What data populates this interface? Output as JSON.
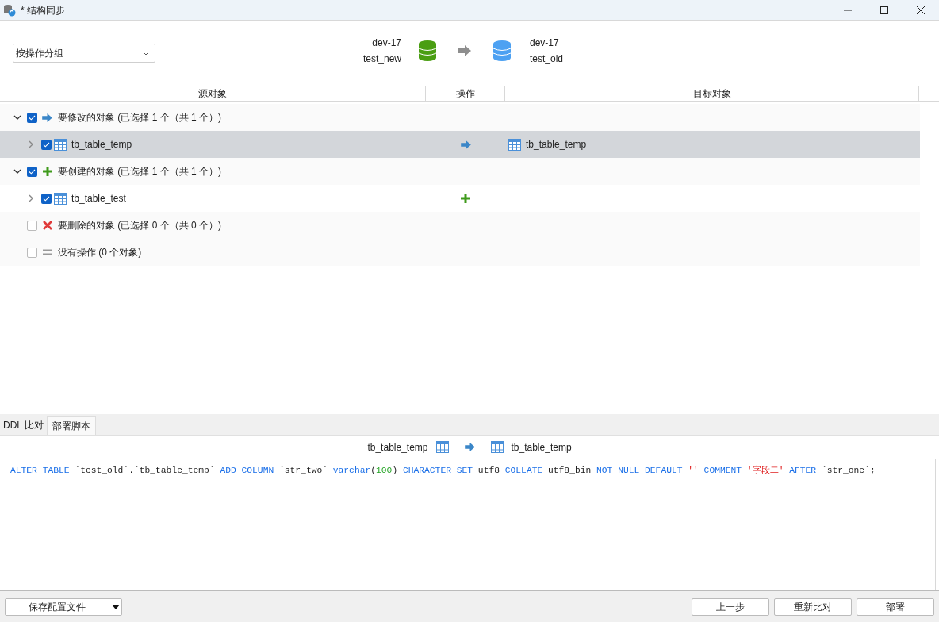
{
  "window": {
    "title": "* 结构同步"
  },
  "group_by": {
    "value": "按操作分组"
  },
  "source": {
    "server": "dev-17",
    "database": "test_new"
  },
  "target": {
    "server": "dev-17",
    "database": "test_old"
  },
  "table": {
    "columns": [
      "源对象",
      "操作",
      "目标对象"
    ],
    "groups": [
      {
        "kind": "modify",
        "label": "要修改的对象 (已选择 1 个（共 1 个）)",
        "checked": true,
        "expanded": true,
        "children": [
          {
            "name": "tb_table_temp",
            "checked": true,
            "selected": true,
            "expanded": false,
            "target": "tb_table_temp"
          }
        ]
      },
      {
        "kind": "create",
        "label": "要创建的对象 (已选择 1 个（共 1 个）)",
        "checked": true,
        "expanded": true,
        "children": [
          {
            "name": "tb_table_test",
            "checked": true,
            "selected": false,
            "expanded": false
          }
        ]
      },
      {
        "kind": "delete",
        "label": "要删除的对象 (已选择 0 个（共 0 个）)",
        "checked": false
      },
      {
        "kind": "none",
        "label": "没有操作 (0 个对象)",
        "checked": false
      }
    ]
  },
  "bottom_tabs": [
    {
      "label": "DDL 比对",
      "selected": false
    },
    {
      "label": "部署脚本",
      "selected": true
    }
  ],
  "script_header": {
    "source": "tb_table_temp",
    "target": "tb_table_temp"
  },
  "script": [
    {
      "kind": "keyword",
      "text": "ALTER TABLE"
    },
    {
      "kind": "plain",
      "text": " `test_old`.`tb_table_temp` "
    },
    {
      "kind": "keyword",
      "text": "ADD COLUMN"
    },
    {
      "kind": "plain",
      "text": " `str_two` "
    },
    {
      "kind": "keyword",
      "text": "varchar"
    },
    {
      "kind": "plain",
      "text": "("
    },
    {
      "kind": "number",
      "text": "100"
    },
    {
      "kind": "plain",
      "text": ") "
    },
    {
      "kind": "keyword",
      "text": "CHARACTER SET"
    },
    {
      "kind": "plain",
      "text": " utf8 "
    },
    {
      "kind": "keyword",
      "text": "COLLATE"
    },
    {
      "kind": "plain",
      "text": " utf8_bin "
    },
    {
      "kind": "keyword",
      "text": "NOT NULL DEFAULT "
    },
    {
      "kind": "string",
      "text": "''"
    },
    {
      "kind": "keyword",
      "text": " COMMENT "
    },
    {
      "kind": "string",
      "text": "'字段二'"
    },
    {
      "kind": "keyword",
      "text": " AFTER"
    },
    {
      "kind": "plain",
      "text": " `str_one`;"
    }
  ],
  "buttons": {
    "left": "保存配置文件",
    "right": [
      "上一步",
      "重新比对",
      "部署"
    ]
  }
}
